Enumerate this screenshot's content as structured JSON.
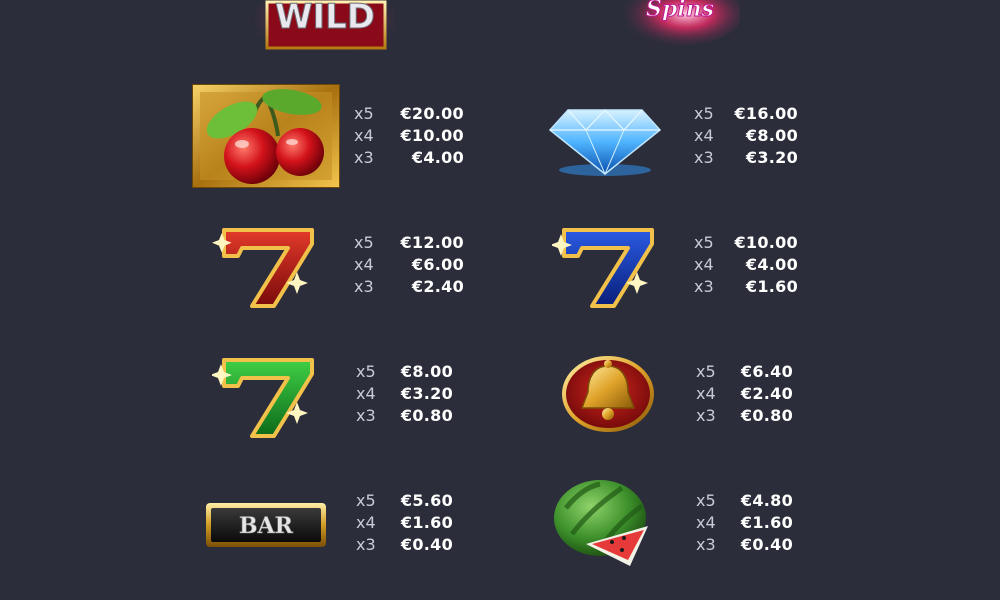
{
  "header": {
    "wild_text": "WILD",
    "spins_text": "Spins"
  },
  "symbols": [
    {
      "name": "cherries",
      "pays": [
        {
          "mult": "x5",
          "value": "€20.00"
        },
        {
          "mult": "x4",
          "value": "€10.00"
        },
        {
          "mult": "x3",
          "value": "€4.00"
        }
      ]
    },
    {
      "name": "diamond",
      "pays": [
        {
          "mult": "x5",
          "value": "€16.00"
        },
        {
          "mult": "x4",
          "value": "€8.00"
        },
        {
          "mult": "x3",
          "value": "€3.20"
        }
      ]
    },
    {
      "name": "red-seven",
      "pays": [
        {
          "mult": "x5",
          "value": "€12.00"
        },
        {
          "mult": "x4",
          "value": "€6.00"
        },
        {
          "mult": "x3",
          "value": "€2.40"
        }
      ]
    },
    {
      "name": "blue-seven",
      "pays": [
        {
          "mult": "x5",
          "value": "€10.00"
        },
        {
          "mult": "x4",
          "value": "€4.00"
        },
        {
          "mult": "x3",
          "value": "€1.60"
        }
      ]
    },
    {
      "name": "green-seven",
      "pays": [
        {
          "mult": "x5",
          "value": "€8.00"
        },
        {
          "mult": "x4",
          "value": "€3.20"
        },
        {
          "mult": "x3",
          "value": "€0.80"
        }
      ]
    },
    {
      "name": "bell",
      "pays": [
        {
          "mult": "x5",
          "value": "€6.40"
        },
        {
          "mult": "x4",
          "value": "€2.40"
        },
        {
          "mult": "x3",
          "value": "€0.80"
        }
      ]
    },
    {
      "name": "bar",
      "label": "BAR",
      "pays": [
        {
          "mult": "x5",
          "value": "€5.60"
        },
        {
          "mult": "x4",
          "value": "€1.60"
        },
        {
          "mult": "x3",
          "value": "€0.40"
        }
      ]
    },
    {
      "name": "watermelon",
      "pays": [
        {
          "mult": "x5",
          "value": "€4.80"
        },
        {
          "mult": "x4",
          "value": "€1.60"
        },
        {
          "mult": "x3",
          "value": "€0.40"
        }
      ]
    }
  ],
  "colors": {
    "background": "#2b2d3b",
    "multiplier": "#c9cbd6",
    "value": "#ffffff"
  }
}
